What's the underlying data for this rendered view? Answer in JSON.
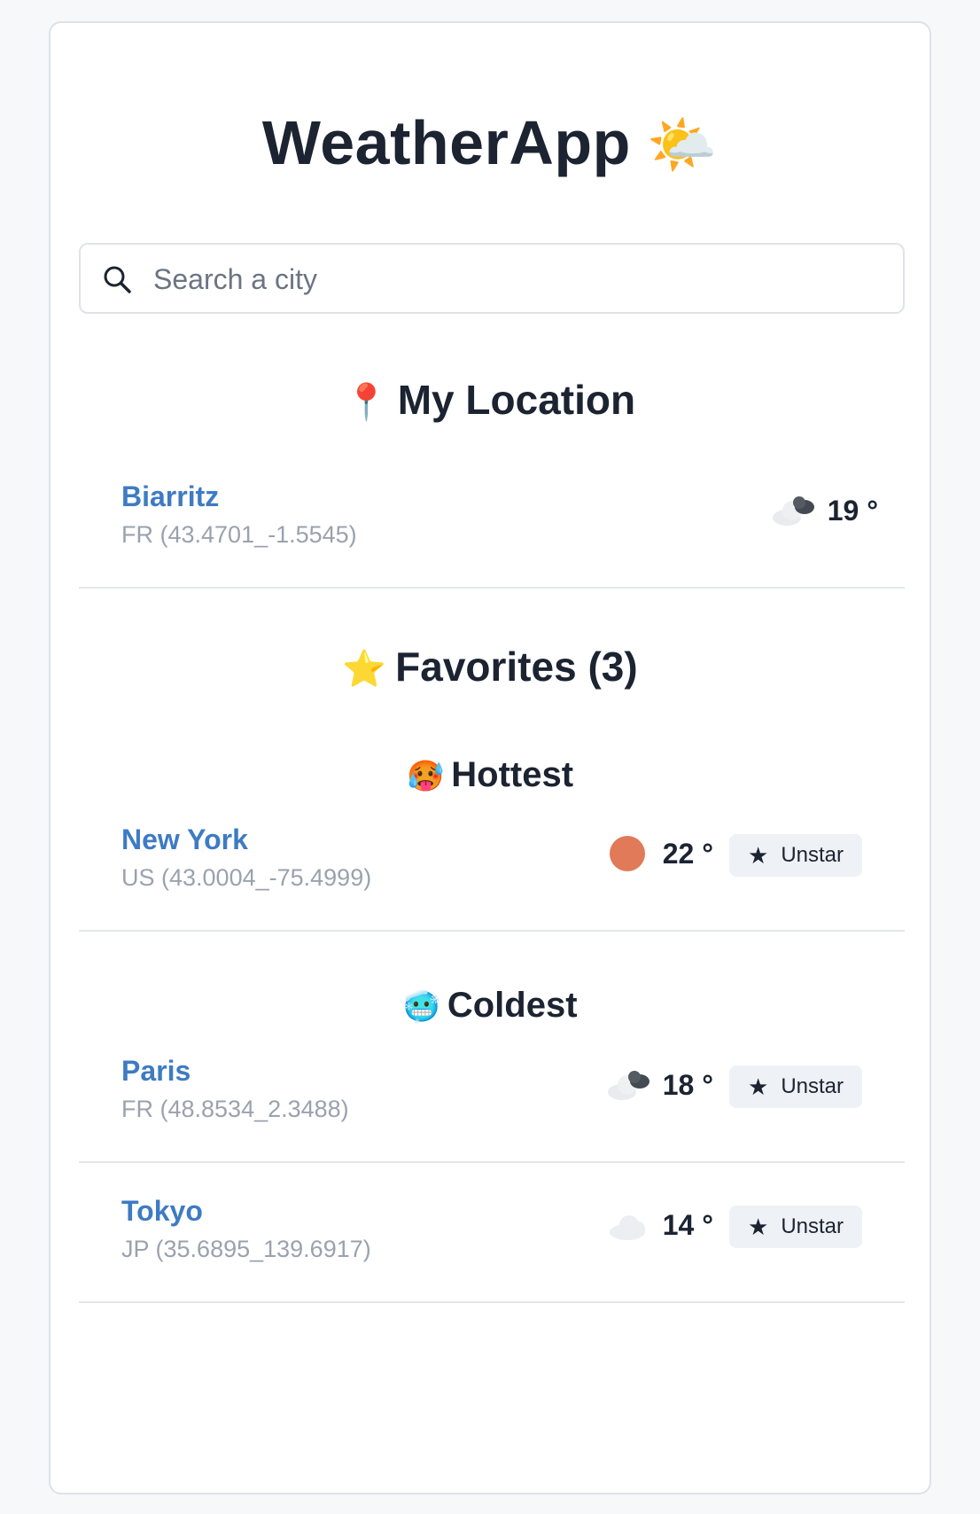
{
  "app": {
    "title": "WeatherApp",
    "title_emoji": "🌤️"
  },
  "search": {
    "placeholder": "Search a city",
    "value": ""
  },
  "my_location": {
    "heading": "My Location",
    "heading_emoji": "📍",
    "city": {
      "name": "Biarritz",
      "coords": "FR (43.4701_-1.5545)",
      "temp": "19 °",
      "weather_icon": "cloud-icon"
    }
  },
  "favorites": {
    "heading": "Favorites (3)",
    "heading_emoji": "⭐",
    "hottest": {
      "heading": "Hottest",
      "heading_emoji": "🥵",
      "cities": [
        {
          "name": "New York",
          "coords": "US (43.0004_-75.4999)",
          "temp": "22 °",
          "weather_icon": "sun-icon",
          "action_label": "Unstar"
        }
      ]
    },
    "coldest": {
      "heading": "Coldest",
      "heading_emoji": "🥶",
      "cities": [
        {
          "name": "Paris",
          "coords": "FR (48.8534_2.3488)",
          "temp": "18 °",
          "weather_icon": "cloud-icon",
          "action_label": "Unstar"
        },
        {
          "name": "Tokyo",
          "coords": "JP (35.6895_139.6917)",
          "temp": "14 °",
          "weather_icon": "light-cloud-icon",
          "action_label": "Unstar"
        }
      ]
    }
  },
  "colors": {
    "link": "#3e7bc4",
    "muted": "#9aa2ae",
    "sun": "#e07a58",
    "button_bg": "#eef1f5"
  }
}
